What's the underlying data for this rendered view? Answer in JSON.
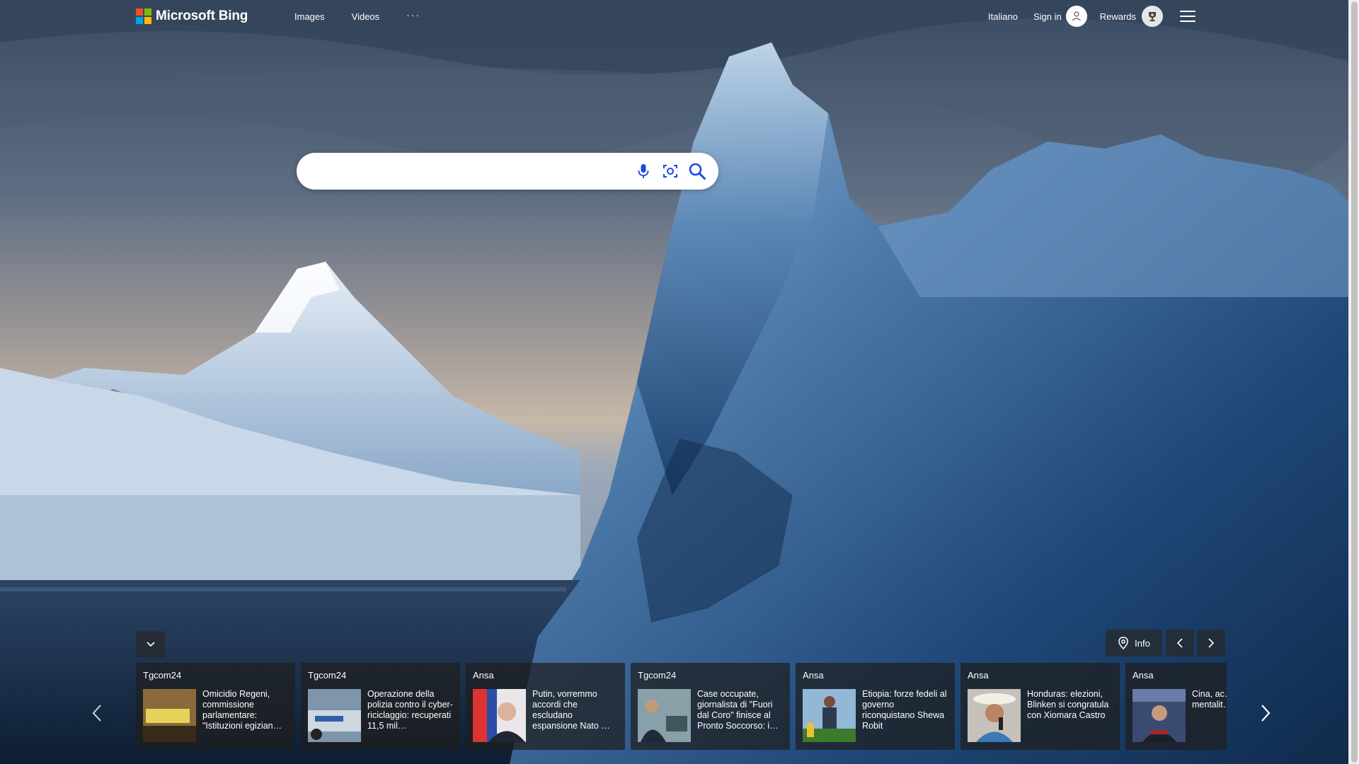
{
  "header": {
    "brand": "Microsoft Bing",
    "nav": [
      {
        "label": "Images"
      },
      {
        "label": "Videos"
      }
    ],
    "more": "···",
    "language": "Italiano",
    "sign_in": "Sign in",
    "rewards": "Rewards"
  },
  "search": {
    "value": "",
    "placeholder": ""
  },
  "bottom": {
    "info_label": "Info"
  },
  "news": [
    {
      "source": "Tgcom24",
      "headline": "Omicidio Regeni, commissione parlamentare: \"Istituzioni egizian…",
      "thumb_color": "#8a6a3a"
    },
    {
      "source": "Tgcom24",
      "headline": "Operazione della polizia contro il cyber-riciclaggio: recuperati 11,5 mil…",
      "thumb_color": "#7e95ad"
    },
    {
      "source": "Ansa",
      "headline": "Putin, vorremmo accordi che escludano espansione Nato …",
      "thumb_color": "#5a6aa0"
    },
    {
      "source": "Tgcom24",
      "headline": "Case occupate, giornalista di \"Fuori dal Coro\" finisce al Pronto Soccorso: i…",
      "thumb_color": "#4e5a60"
    },
    {
      "source": "Ansa",
      "headline": "Etiopia: forze fedeli al governo riconquistano Shewa Robit",
      "thumb_color": "#6a8a5a"
    },
    {
      "source": "Ansa",
      "headline": "Honduras: elezioni, Blinken si congratula con Xiomara Castro",
      "thumb_color": "#a07050"
    },
    {
      "source": "Ansa",
      "headline": "Cina, ac… intelliger… mentalit… Fredda",
      "thumb_color": "#3a4a70"
    }
  ],
  "colors": {
    "ms_red": "#f25022",
    "ms_green": "#7fba00",
    "ms_blue": "#00a4ef",
    "ms_yellow": "#ffb900",
    "search_icon": "#174ae4"
  }
}
